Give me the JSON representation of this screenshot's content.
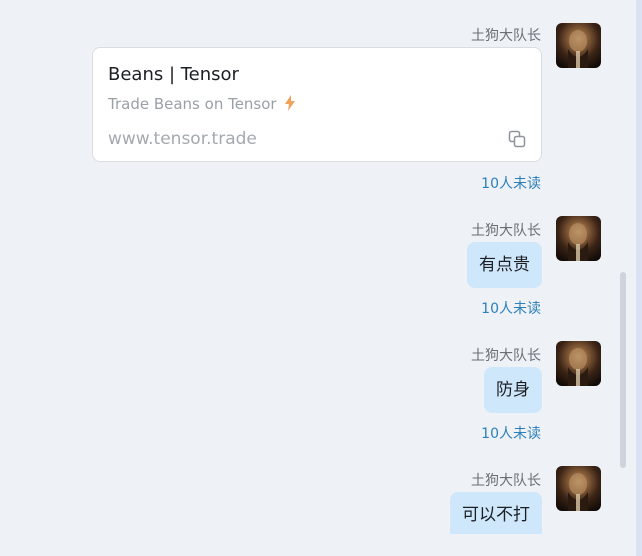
{
  "messages": [
    {
      "sender": "土狗大队长",
      "type": "link-card",
      "card": {
        "title": "Beans | Tensor",
        "description": "Trade Beans on Tensor",
        "url": "www.tensor.trade"
      },
      "read_status": "10人未读"
    },
    {
      "sender": "土狗大队长",
      "type": "text",
      "text": "有点贵",
      "read_status": "10人未读"
    },
    {
      "sender": "土狗大队长",
      "type": "text",
      "text": "防身",
      "read_status": "10人未读"
    },
    {
      "sender": "土狗大队长",
      "type": "text",
      "text": "可以不打"
    }
  ],
  "icons": {
    "card_icon": "bolt-icon",
    "copy": "copy-icon"
  },
  "colors": {
    "background": "#eef1f6",
    "bubble": "#cfe7fb",
    "unread_text": "#2c7fb8",
    "bolt": "#f0a257"
  }
}
